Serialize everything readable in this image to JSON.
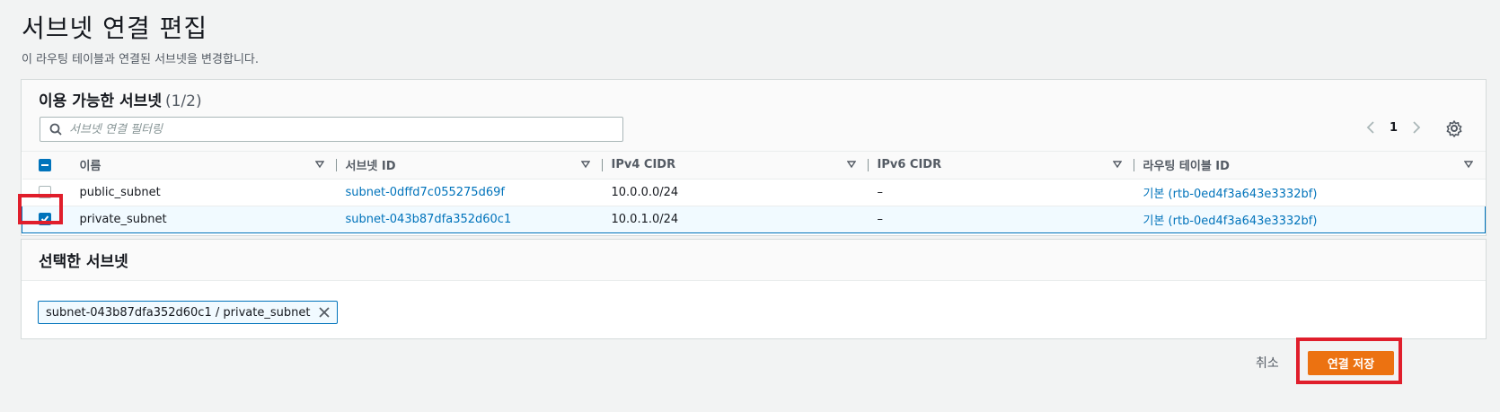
{
  "page": {
    "title": "서브넷 연결 편집",
    "description": "이 라우팅 테이블과 연결된 서브넷을 변경합니다."
  },
  "available": {
    "title": "이용 가능한 서브넷",
    "count": "(1/2)",
    "search_placeholder": "서브넷 연결 필터링",
    "page_number": "1",
    "columns": [
      "이름",
      "서브넷 ID",
      "IPv4 CIDR",
      "IPv6 CIDR",
      "라우팅 테이블 ID"
    ],
    "rows": [
      {
        "name": "public_subnet",
        "subnet_id": "subnet-0dffd7c055275d69f",
        "ipv4": "10.0.0.0/24",
        "ipv6": "–",
        "route_table": "기본 (rtb-0ed4f3a643e3332bf)",
        "selected": false
      },
      {
        "name": "private_subnet",
        "subnet_id": "subnet-043b87dfa352d60c1",
        "ipv4": "10.0.1.0/24",
        "ipv6": "–",
        "route_table": "기본 (rtb-0ed4f3a643e3332bf)",
        "selected": true
      }
    ]
  },
  "selected_panel": {
    "title": "선택한 서브넷",
    "token_label": "subnet-043b87dfa352d60c1 / private_subnet"
  },
  "footer": {
    "cancel_label": "취소",
    "save_label": "연결 저장"
  },
  "colors": {
    "accent": "#0073bb",
    "primary_button": "#ec7211",
    "highlight": "#e01e2b"
  }
}
